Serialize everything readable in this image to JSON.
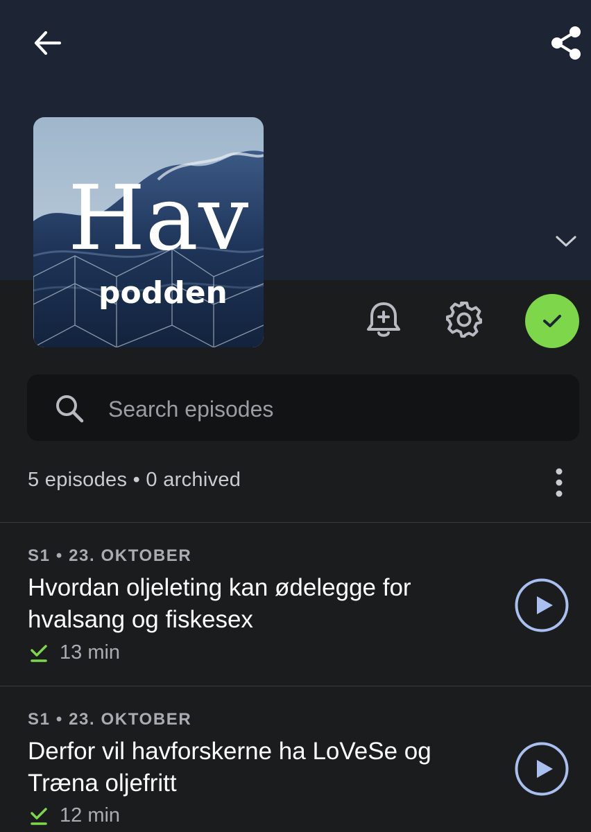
{
  "header": {
    "back_icon": "arrow-left-icon",
    "share_icon": "share-icon",
    "expand_icon": "chevron-down-icon"
  },
  "podcast": {
    "artwork_title": "Hav",
    "artwork_subtitle": "podden"
  },
  "actions": {
    "notifications_icon": "bell-plus-icon",
    "settings_icon": "gear-icon",
    "subscribed_icon": "check-icon",
    "subscribed_color": "#7ed64a"
  },
  "search": {
    "placeholder": "Search episodes",
    "value": ""
  },
  "summary": {
    "text": "5 episodes • 0 archived",
    "menu_icon": "more-vert-icon"
  },
  "episodes": [
    {
      "meta": "S1 • 23. OKTOBER",
      "title": "Hvordan oljeleting kan ødelegge for hvalsang og fiskesex",
      "duration": "13 min",
      "played_icon": "check-underline-icon"
    },
    {
      "meta": "S1 • 23. OKTOBER",
      "title": "Derfor vil havforskerne ha LoVeSe  og Træna oljefritt",
      "duration": "12 min",
      "played_icon": "check-underline-icon"
    }
  ],
  "colors": {
    "header_bg": "#1d2534",
    "background": "#1b1c1e",
    "accent_green": "#7ed64a",
    "play_accent": "#a9bff0"
  }
}
